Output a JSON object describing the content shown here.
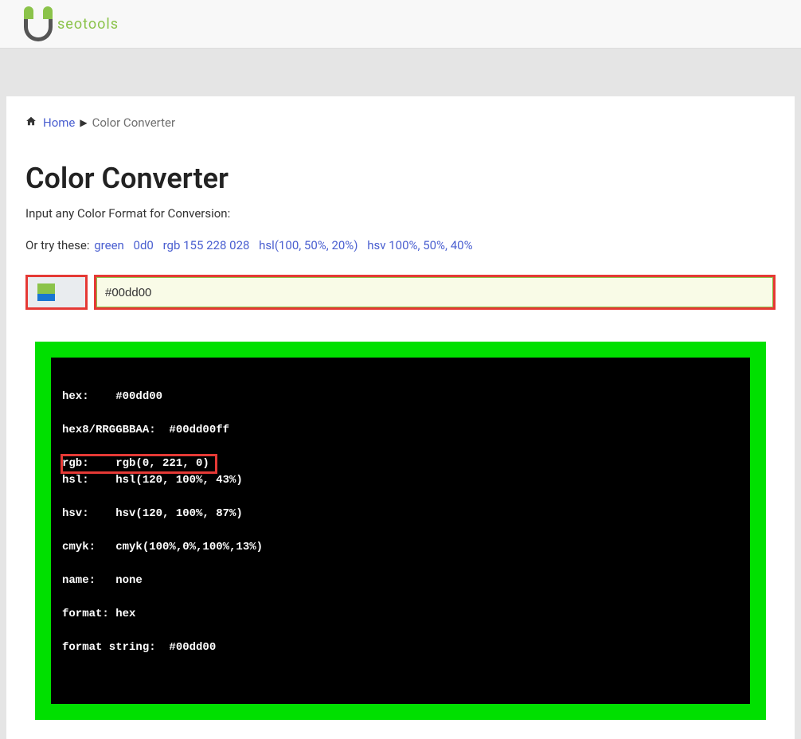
{
  "logo": {
    "text": "seotools"
  },
  "breadcrumb": {
    "home_label": "Home",
    "current": "Color Converter"
  },
  "page": {
    "title": "Color Converter",
    "subtitle": "Input any Color Format for Conversion:",
    "try_prefix": "Or try these:"
  },
  "examples": {
    "green": "green",
    "hex3": "0d0",
    "rgb": "rgb 155 228 028",
    "hsl": "hsl(100, 50%, 20%)",
    "hsv": "hsv 100%, 50%, 40%"
  },
  "input": {
    "value": "#00dd00"
  },
  "output": {
    "hex": "hex:    #00dd00",
    "hex8": "hex8/RRGGBBAA:  #00dd00ff",
    "rgb": "rgb:    rgb(0, 221, 0)",
    "hsl": "hsl:    hsl(120, 100%, 43%)",
    "hsv": "hsv:    hsv(120, 100%, 87%)",
    "cmyk": "cmyk:   cmyk(100%,0%,100%,13%)",
    "name": "name:   none",
    "format": "format: hex",
    "format_string": "format string:  #00dd00"
  }
}
